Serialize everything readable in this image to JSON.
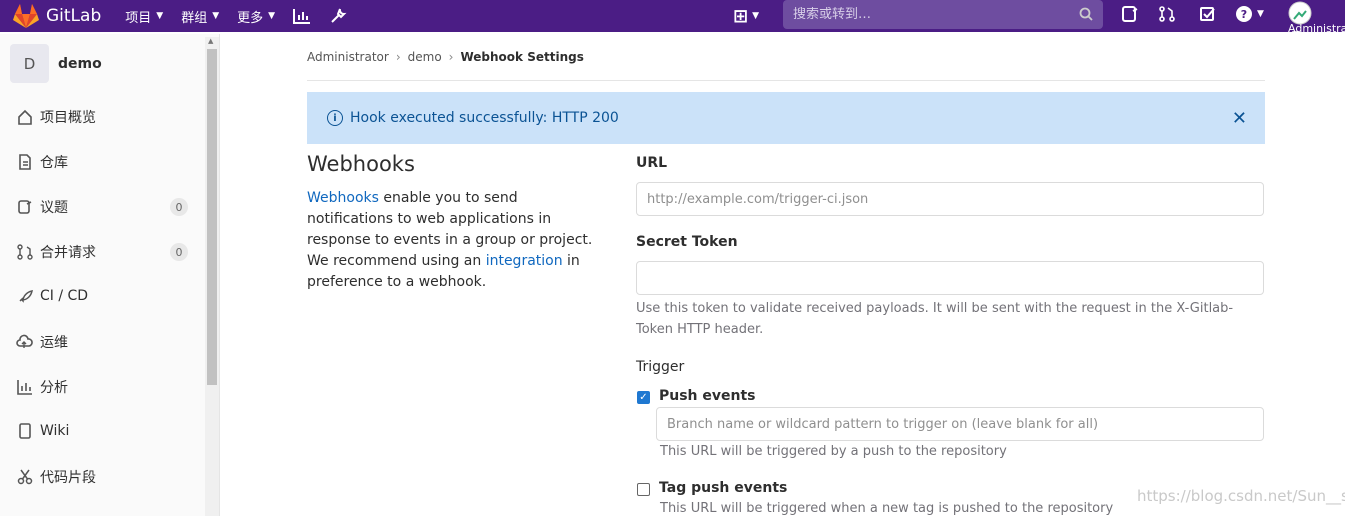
{
  "navbar": {
    "brand": "GitLab",
    "menu": [
      {
        "label": "项目"
      },
      {
        "label": "群组"
      },
      {
        "label": "更多"
      }
    ],
    "search_placeholder": "搜索或转到…",
    "user_label": "Administrator"
  },
  "sidebar": {
    "project_initial": "D",
    "project_name": "demo",
    "items": [
      {
        "label": "项目概览",
        "icon": "home-icon"
      },
      {
        "label": "仓库",
        "icon": "doc-icon"
      },
      {
        "label": "议题",
        "icon": "issues-icon",
        "count": "0"
      },
      {
        "label": "合并请求",
        "icon": "merge-request-icon",
        "count": "0"
      },
      {
        "label": "CI / CD",
        "icon": "rocket-icon"
      },
      {
        "label": "运维",
        "icon": "cloud-icon"
      },
      {
        "label": "分析",
        "icon": "chart-icon"
      },
      {
        "label": "Wiki",
        "icon": "book-icon"
      },
      {
        "label": "代码片段",
        "icon": "scissors-icon"
      }
    ]
  },
  "breadcrumb": {
    "items": [
      "Administrator",
      "demo"
    ],
    "current": "Webhook Settings"
  },
  "flash": {
    "message": "Hook executed successfully: HTTP 200"
  },
  "webhooks": {
    "title": "Webhooks",
    "desc_link1": "Webhooks",
    "desc_part1": " enable you to send notifications to web applications in response to events in a group or project. We recommend using an ",
    "desc_link2": "integration",
    "desc_part2": " in preference to a webhook."
  },
  "form": {
    "url_label": "URL",
    "url_placeholder": "http://example.com/trigger-ci.json",
    "token_label": "Secret Token",
    "token_value": "",
    "token_help": "Use this token to validate received payloads. It will be sent with the request in the X-Gitlab-Token HTTP header.",
    "trigger_label": "Trigger",
    "push_label": "Push events",
    "push_checked": true,
    "push_placeholder": "Branch name or wildcard pattern to trigger on (leave blank for all)",
    "push_help": "This URL will be triggered by a push to the repository",
    "tag_label": "Tag push events",
    "tag_checked": false,
    "tag_help": "This URL will be triggered when a new tag is pushed to the repository"
  },
  "watermark": "https://blog.csdn.net/Sun__s",
  "colors": {
    "navbar": "#4b1d85",
    "flash_bg": "#cbe2f9",
    "link": "#1068bf"
  }
}
